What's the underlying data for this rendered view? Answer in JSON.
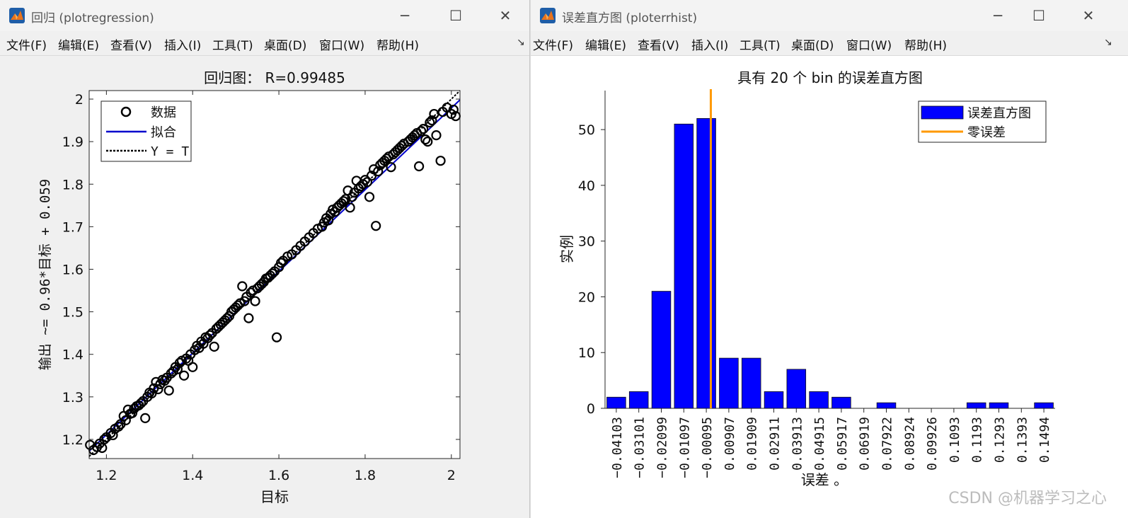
{
  "left_window": {
    "title": "回归 (plotregression)",
    "menu": [
      "文件(F)",
      "编辑(E)",
      "查看(V)",
      "插入(I)",
      "工具(T)",
      "桌面(D)",
      "窗口(W)",
      "帮助(H)"
    ],
    "controls": {
      "minimize": "─",
      "maximize": "☐",
      "close": "✕"
    },
    "toolbar_arrow": "↘"
  },
  "right_window": {
    "title": "误差直方图 (ploterrhist)",
    "menu": [
      "文件(F)",
      "编辑(E)",
      "查看(V)",
      "插入(I)",
      "工具(T)",
      "桌面(D)",
      "窗口(W)",
      "帮助(H)"
    ],
    "controls": {
      "minimize": "─",
      "maximize": "☐",
      "close": "✕"
    },
    "toolbar_arrow": "↘"
  },
  "chart_data": [
    {
      "type": "scatter",
      "title": "回归图： R=0.99485",
      "xlabel": "目标",
      "ylabel": "输出 ~= 0.96*目标 + 0.059",
      "xlim": [
        1.16,
        2.02
      ],
      "ylim": [
        1.155,
        2.02
      ],
      "xticks": [
        1.2,
        1.4,
        1.6,
        1.8,
        2
      ],
      "xtick_labels": [
        "1.2",
        "1.4",
        "1.6",
        "1.8",
        "2"
      ],
      "yticks": [
        1.2,
        1.3,
        1.4,
        1.5,
        1.6,
        1.7,
        1.8,
        1.9,
        2
      ],
      "ytick_labels": [
        "1.2",
        "1.3",
        "1.4",
        "1.5",
        "1.6",
        "1.7",
        "1.8",
        "1.9",
        "2"
      ],
      "fit": {
        "slope": 0.96,
        "intercept": 0.059
      },
      "legend": {
        "position": "top-left",
        "entries": [
          "数据",
          "拟合",
          "Y = T"
        ]
      },
      "colors": {
        "data": "#000000",
        "fit": "#0000cc",
        "identity": "#000000"
      },
      "points": [
        [
          1.162,
          1.187
        ],
        [
          1.17,
          1.175
        ],
        [
          1.178,
          1.182
        ],
        [
          1.184,
          1.19
        ],
        [
          1.19,
          1.18
        ],
        [
          1.195,
          1.2
        ],
        [
          1.2,
          1.205
        ],
        [
          1.21,
          1.215
        ],
        [
          1.215,
          1.21
        ],
        [
          1.22,
          1.225
        ],
        [
          1.228,
          1.23
        ],
        [
          1.233,
          1.236
        ],
        [
          1.24,
          1.255
        ],
        [
          1.245,
          1.245
        ],
        [
          1.25,
          1.27
        ],
        [
          1.255,
          1.26
        ],
        [
          1.26,
          1.262
        ],
        [
          1.264,
          1.272
        ],
        [
          1.27,
          1.278
        ],
        [
          1.275,
          1.28
        ],
        [
          1.28,
          1.285
        ],
        [
          1.285,
          1.29
        ],
        [
          1.29,
          1.25
        ],
        [
          1.295,
          1.3
        ],
        [
          1.3,
          1.31
        ],
        [
          1.305,
          1.308
        ],
        [
          1.31,
          1.32
        ],
        [
          1.315,
          1.335
        ],
        [
          1.32,
          1.318
        ],
        [
          1.325,
          1.33
        ],
        [
          1.33,
          1.34
        ],
        [
          1.335,
          1.338
        ],
        [
          1.34,
          1.345
        ],
        [
          1.345,
          1.315
        ],
        [
          1.35,
          1.355
        ],
        [
          1.355,
          1.36
        ],
        [
          1.36,
          1.37
        ],
        [
          1.365,
          1.365
        ],
        [
          1.37,
          1.38
        ],
        [
          1.375,
          1.385
        ],
        [
          1.38,
          1.35
        ],
        [
          1.385,
          1.39
        ],
        [
          1.39,
          1.385
        ],
        [
          1.395,
          1.4
        ],
        [
          1.4,
          1.37
        ],
        [
          1.405,
          1.41
        ],
        [
          1.41,
          1.42
        ],
        [
          1.415,
          1.415
        ],
        [
          1.42,
          1.43
        ],
        [
          1.425,
          1.425
        ],
        [
          1.43,
          1.44
        ],
        [
          1.435,
          1.438
        ],
        [
          1.44,
          1.445
        ],
        [
          1.445,
          1.45
        ],
        [
          1.45,
          1.418
        ],
        [
          1.455,
          1.46
        ],
        [
          1.46,
          1.465
        ],
        [
          1.465,
          1.47
        ],
        [
          1.47,
          1.475
        ],
        [
          1.475,
          1.48
        ],
        [
          1.48,
          1.485
        ],
        [
          1.485,
          1.49
        ],
        [
          1.49,
          1.5
        ],
        [
          1.495,
          1.505
        ],
        [
          1.5,
          1.51
        ],
        [
          1.505,
          1.515
        ],
        [
          1.51,
          1.52
        ],
        [
          1.515,
          1.56
        ],
        [
          1.52,
          1.525
        ],
        [
          1.525,
          1.535
        ],
        [
          1.53,
          1.485
        ],
        [
          1.535,
          1.545
        ],
        [
          1.54,
          1.55
        ],
        [
          1.545,
          1.525
        ],
        [
          1.55,
          1.555
        ],
        [
          1.555,
          1.56
        ],
        [
          1.56,
          1.565
        ],
        [
          1.565,
          1.57
        ],
        [
          1.57,
          1.578
        ],
        [
          1.575,
          1.58
        ],
        [
          1.58,
          1.585
        ],
        [
          1.585,
          1.59
        ],
        [
          1.59,
          1.595
        ],
        [
          1.595,
          1.44
        ],
        [
          1.6,
          1.605
        ],
        [
          1.605,
          1.615
        ],
        [
          1.61,
          1.62
        ],
        [
          1.62,
          1.63
        ],
        [
          1.63,
          1.635
        ],
        [
          1.64,
          1.645
        ],
        [
          1.65,
          1.655
        ],
        [
          1.66,
          1.665
        ],
        [
          1.67,
          1.675
        ],
        [
          1.68,
          1.685
        ],
        [
          1.69,
          1.695
        ],
        [
          1.7,
          1.7
        ],
        [
          1.705,
          1.71
        ],
        [
          1.71,
          1.72
        ],
        [
          1.715,
          1.715
        ],
        [
          1.72,
          1.73
        ],
        [
          1.725,
          1.74
        ],
        [
          1.73,
          1.735
        ],
        [
          1.735,
          1.745
        ],
        [
          1.74,
          1.75
        ],
        [
          1.745,
          1.755
        ],
        [
          1.75,
          1.76
        ],
        [
          1.755,
          1.765
        ],
        [
          1.76,
          1.785
        ],
        [
          1.765,
          1.745
        ],
        [
          1.77,
          1.77
        ],
        [
          1.775,
          1.78
        ],
        [
          1.78,
          1.808
        ],
        [
          1.785,
          1.79
        ],
        [
          1.79,
          1.795
        ],
        [
          1.795,
          1.8
        ],
        [
          1.8,
          1.81
        ],
        [
          1.805,
          1.805
        ],
        [
          1.81,
          1.77
        ],
        [
          1.815,
          1.82
        ],
        [
          1.82,
          1.835
        ],
        [
          1.825,
          1.702
        ],
        [
          1.83,
          1.83
        ],
        [
          1.835,
          1.845
        ],
        [
          1.84,
          1.85
        ],
        [
          1.845,
          1.855
        ],
        [
          1.85,
          1.86
        ],
        [
          1.855,
          1.865
        ],
        [
          1.86,
          1.84
        ],
        [
          1.865,
          1.87
        ],
        [
          1.87,
          1.875
        ],
        [
          1.875,
          1.88
        ],
        [
          1.88,
          1.885
        ],
        [
          1.885,
          1.89
        ],
        [
          1.89,
          1.895
        ],
        [
          1.9,
          1.9
        ],
        [
          1.905,
          1.905
        ],
        [
          1.91,
          1.91
        ],
        [
          1.915,
          1.915
        ],
        [
          1.92,
          1.92
        ],
        [
          1.925,
          1.842
        ],
        [
          1.93,
          1.925
        ],
        [
          1.935,
          1.93
        ],
        [
          1.94,
          1.905
        ],
        [
          1.945,
          1.9
        ],
        [
          1.95,
          1.945
        ],
        [
          1.955,
          1.95
        ],
        [
          1.96,
          1.965
        ],
        [
          1.965,
          1.915
        ],
        [
          1.975,
          1.855
        ],
        [
          1.98,
          1.97
        ],
        [
          1.99,
          1.98
        ],
        [
          2.0,
          1.965
        ],
        [
          2.005,
          1.975
        ],
        [
          2.01,
          1.96
        ]
      ]
    },
    {
      "type": "bar",
      "title": "具有 20 个 bin 的误差直方图",
      "xlabel": "误差 。",
      "ylabel": "实例",
      "ylim": [
        0,
        57
      ],
      "yticks": [
        0,
        10,
        20,
        30,
        40,
        50
      ],
      "ytick_labels": [
        "0",
        "10",
        "20",
        "30",
        "40",
        "50"
      ],
      "categories": [
        "-0.04103",
        "-0.03101",
        "-0.02099",
        "-0.01097",
        "-0.00095",
        "0.00907",
        "0.01909",
        "0.02911",
        "0.03913",
        "0.04915",
        "0.05917",
        "0.06919",
        "0.07922",
        "0.08924",
        "0.09926",
        "0.1093",
        "0.1193",
        "0.1293",
        "0.1393",
        "0.1494"
      ],
      "values": [
        2,
        3,
        21,
        51,
        52,
        9,
        9,
        3,
        7,
        3,
        2,
        0,
        1,
        0,
        0,
        0,
        1,
        1,
        0,
        1
      ],
      "zero_error_index": 4.2,
      "legend": {
        "position": "top-right",
        "entries": [
          "误差直方图",
          "零误差"
        ]
      },
      "colors": {
        "bars": "#0000ff",
        "zero_line": "#ff9900"
      }
    }
  ],
  "watermark": "CSDN @机器学习之心"
}
